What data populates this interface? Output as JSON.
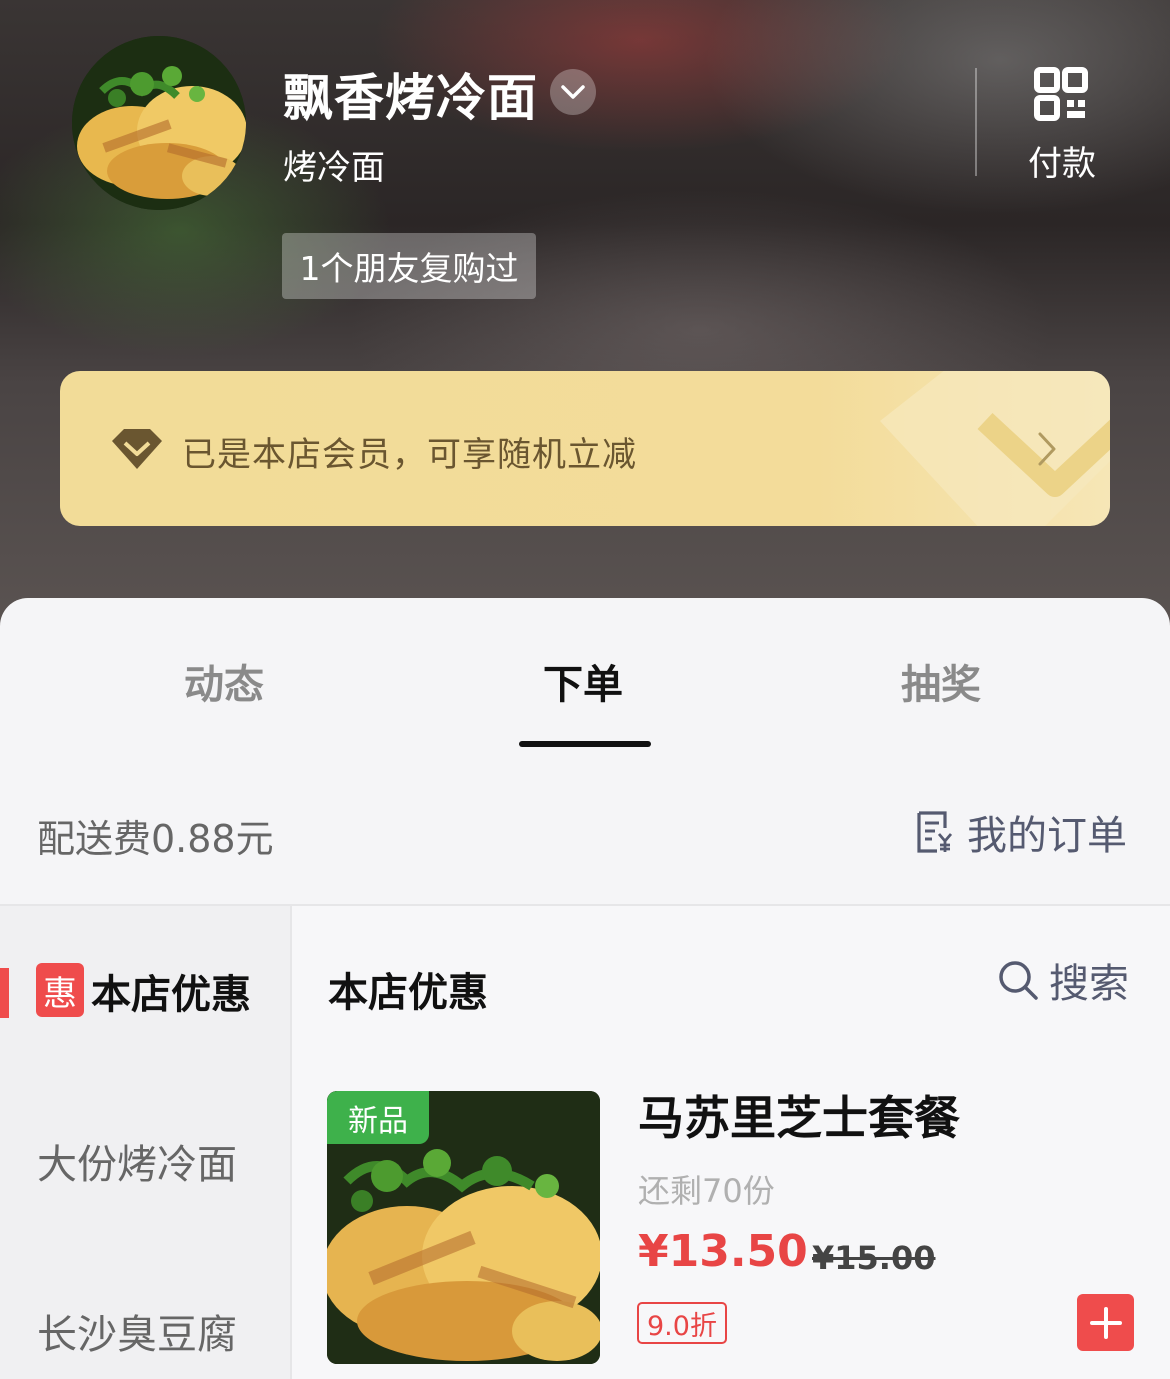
{
  "header": {
    "store_name": "飘香烤冷面",
    "store_category": "烤冷面",
    "friend_badge": "1个朋友复购过",
    "pay_label": "付款"
  },
  "member_card": {
    "text": "已是本店会员，可享随机立减"
  },
  "tabs": [
    {
      "label": "动态",
      "active": false
    },
    {
      "label": "下单",
      "active": true
    },
    {
      "label": "抽奖",
      "active": false
    }
  ],
  "order_bar": {
    "delivery_fee": "配送费0.88元",
    "my_orders": "我的订单"
  },
  "sidebar": {
    "badge": "惠",
    "items": [
      {
        "label": "本店优惠",
        "active": true
      },
      {
        "label": "大份烤冷面",
        "active": false
      },
      {
        "label": "长沙臭豆腐",
        "active": false
      }
    ]
  },
  "main": {
    "section_title": "本店优惠",
    "search_label": "搜索",
    "products": [
      {
        "tag": "新品",
        "name": "马苏里芝士套餐",
        "stock": "还剩70份",
        "price": "¥13.50",
        "original_price": "¥15.00",
        "discount": "9.0折"
      }
    ]
  },
  "colors": {
    "accent_red": "#ef4c4c",
    "price_red": "#e84545",
    "new_tag_green": "#3eb14b",
    "member_gold": "#f2dc98"
  },
  "icons": [
    "chevron-down-icon",
    "qr-code-icon",
    "diamond-icon",
    "chevron-right-icon",
    "receipt-icon",
    "search-icon",
    "plus-icon"
  ]
}
